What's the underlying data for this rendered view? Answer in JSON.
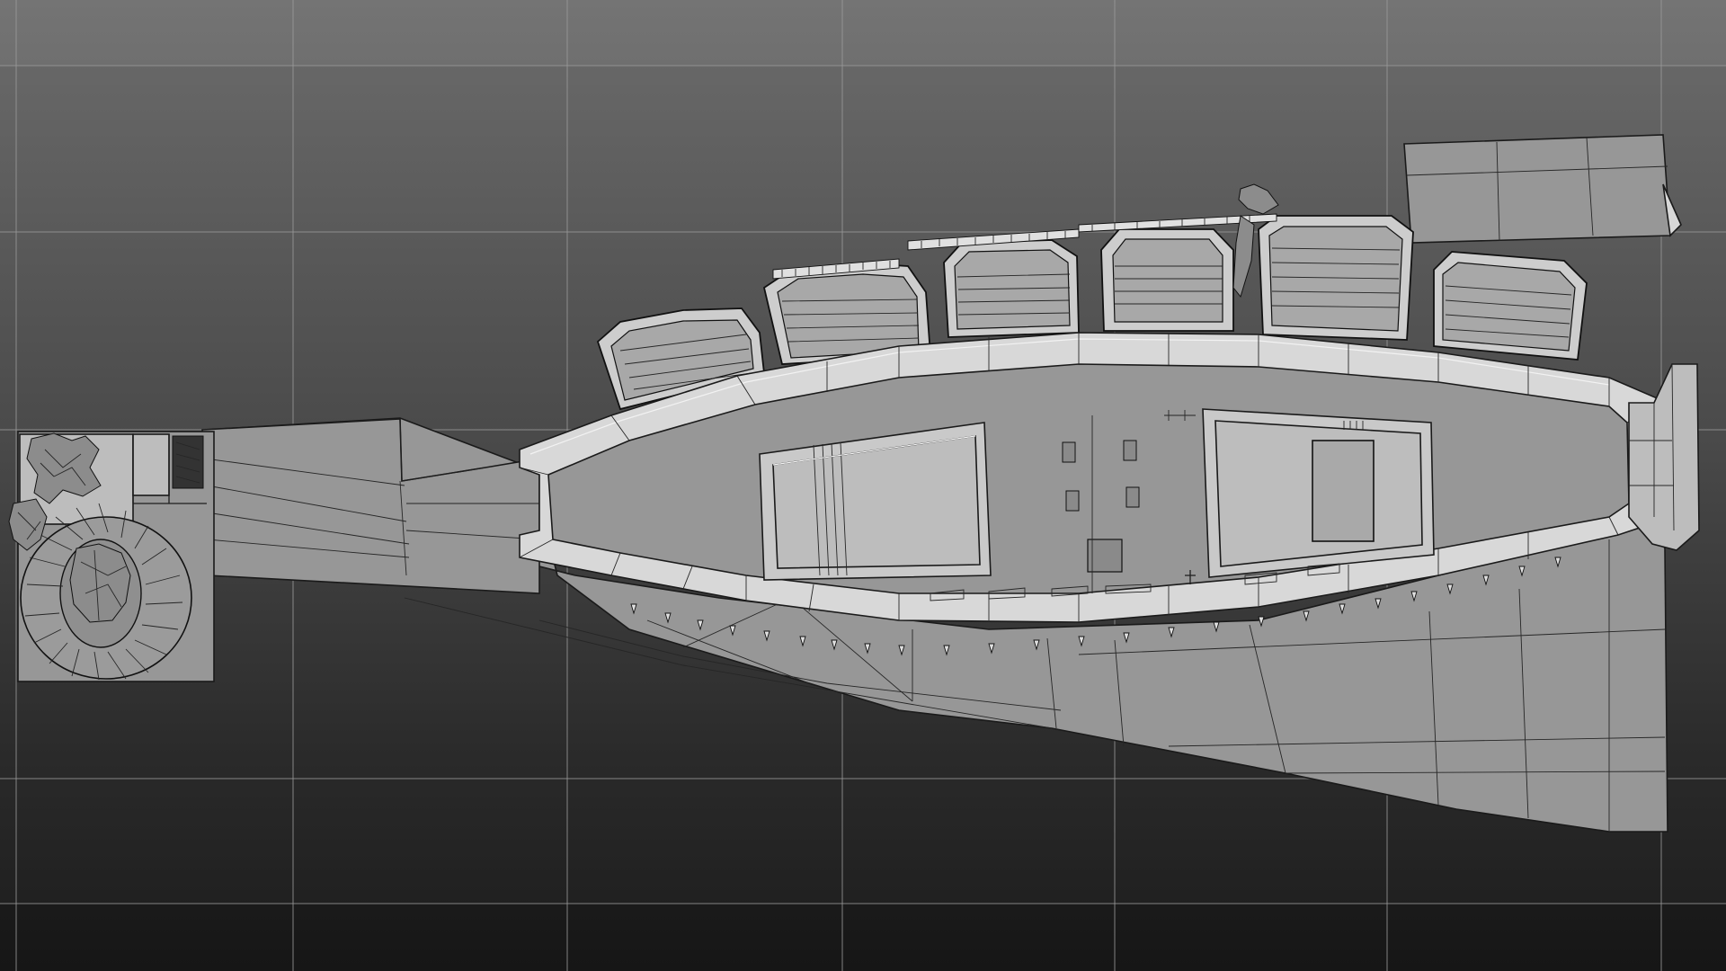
{
  "view": {
    "projection": "top",
    "background_gradient": [
      "#6c6c6c",
      "#1c1c1c"
    ],
    "grid_line_color": "#9a9a9a",
    "mesh_fill_color": "#979797",
    "mesh_highlight_color": "#d8d8d8",
    "wireframe_color": "#1a1a1a",
    "grid_visible": true
  }
}
